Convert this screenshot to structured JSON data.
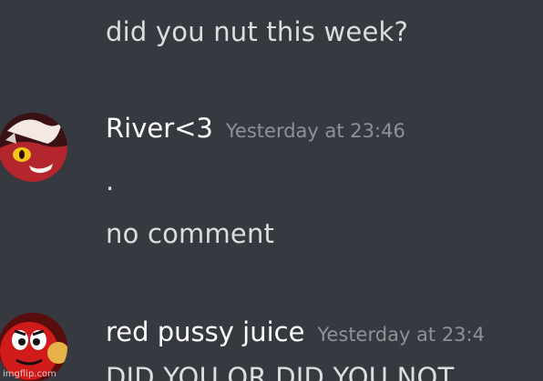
{
  "messages": [
    {
      "continuation_text": "did you nut this week?"
    },
    {
      "username": "River<3",
      "timestamp": "Yesterday at 23:46",
      "lines": [
        ".",
        "no comment"
      ],
      "avatar_icon": "demon-character-avatar"
    },
    {
      "username": "red pussy juice",
      "timestamp": "Yesterday at 23:4",
      "lines": [
        "DID YOU OR DID YOU NOT"
      ],
      "avatar_icon": "red-candy-character-avatar"
    }
  ],
  "watermark": "imgflip.com",
  "colors": {
    "background": "#36393f",
    "username": "#ffffff",
    "message_text": "#dcddde",
    "timestamp": "#8e9297"
  }
}
